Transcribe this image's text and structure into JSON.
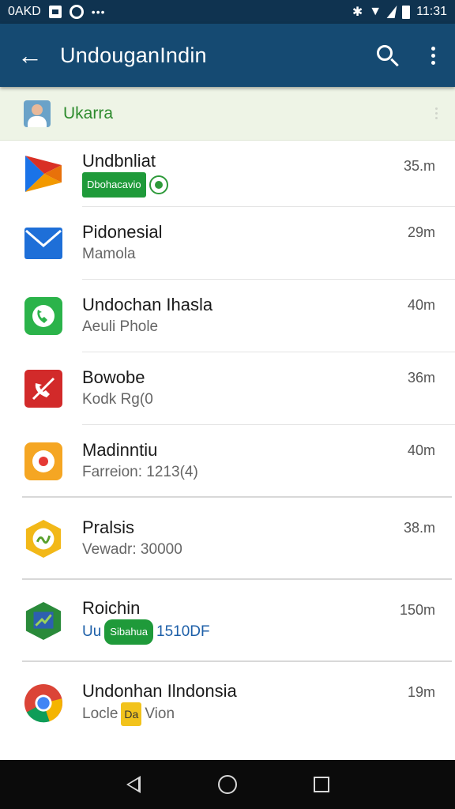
{
  "status_bar": {
    "left_text": "0AKD",
    "right_time": "11:31"
  },
  "app_bar": {
    "title": "UndouganIndin"
  },
  "account": {
    "name": "Ukarra"
  },
  "items": [
    {
      "title": "Undbnliat",
      "subtitle": "Dbohacavio",
      "time": "35.m"
    },
    {
      "title": "Pidonesial",
      "subtitle": "Mamola",
      "time": "29m"
    },
    {
      "title": "Undochan Ihasla",
      "subtitle": "Aeuli Phole",
      "time": "40m"
    },
    {
      "title": "Bowobe",
      "subtitle": "Kodk Rg(0",
      "time": "36m"
    },
    {
      "title": "Madinntiu",
      "subtitle": "Farreion: 1213(4)",
      "time": "40m"
    },
    {
      "title": "Pralsis",
      "subtitle": "Vewadr: 30000",
      "time": "38.m"
    },
    {
      "title": "Roichin",
      "subtitle_prefix": "Uu",
      "subtitle_badge": "Sibahua",
      "subtitle": "1510DF",
      "time": "150m"
    },
    {
      "title": "Undonhan Ilndonsia",
      "subtitle_prefix": "Locle",
      "subtitle_badge": "Da",
      "subtitle": "Vion",
      "time": "19m"
    }
  ],
  "icons": {
    "item1": "play-store-icon",
    "item2": "mail-icon",
    "item3": "phone-icon",
    "item4": "no-call-icon",
    "item5": "record-icon",
    "item6": "badge-icon",
    "item7": "shield-icon",
    "item8": "chrome-icon"
  },
  "colors": {
    "status_bar": "#0f3350",
    "app_bar": "#154a72",
    "account_bar": "#eef4e6",
    "accent_green": "#2e8b2e",
    "nav_bar": "#0b0b0b"
  }
}
